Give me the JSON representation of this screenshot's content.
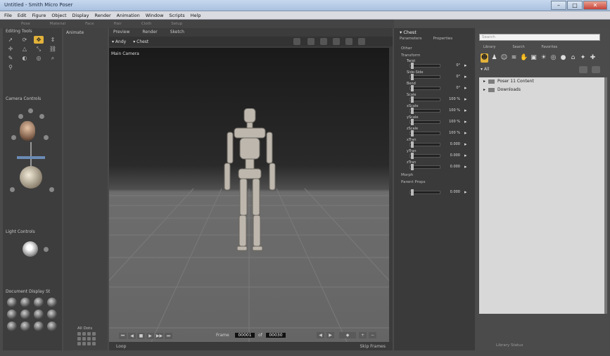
{
  "window": {
    "title": "Untitled - Smith Micro Poser"
  },
  "menu": [
    "File",
    "Edit",
    "Figure",
    "Object",
    "Display",
    "Render",
    "Animation",
    "Window",
    "Scripts",
    "Help"
  ],
  "room_tabs": [
    "Pose",
    "Material",
    "Face",
    "Hair",
    "Cloth",
    "Setup"
  ],
  "editing_tools": {
    "title": "Editing Tools"
  },
  "camera_controls": {
    "title": "Camera Controls"
  },
  "light_controls": {
    "title": "Light Controls"
  },
  "document_display": {
    "title": "Document Display St"
  },
  "anim": {
    "label": "Animate",
    "all_dots": "All Dots"
  },
  "viewport": {
    "tabs": [
      "Preview",
      "Render",
      "Sketch"
    ],
    "dropdowns": [
      "Andy",
      "Chest"
    ],
    "camera_label": "Main Camera"
  },
  "frame": {
    "label": "Frame",
    "current": "00001",
    "of": "of",
    "total": "00030"
  },
  "bottom": {
    "loop": "Loop",
    "skip": "Skip Frames"
  },
  "params": {
    "header": "Chest",
    "tabs": [
      "Parameters",
      "Properties"
    ],
    "group_other": "Other",
    "group_transform": "Transform",
    "rows": [
      {
        "name": "Twist",
        "value": "0°"
      },
      {
        "name": "Side-Side",
        "value": "0°"
      },
      {
        "name": "Bend",
        "value": "0°"
      },
      {
        "name": "Scale",
        "value": "100 %"
      },
      {
        "name": "xScale",
        "value": "100 %"
      },
      {
        "name": "yScale",
        "value": "100 %"
      },
      {
        "name": "zScale",
        "value": "100 %"
      },
      {
        "name": "xTran",
        "value": "0.000"
      },
      {
        "name": "yTran",
        "value": "0.000"
      },
      {
        "name": "zTran",
        "value": "0.000"
      }
    ],
    "group_morph": "Morph",
    "group_parent": "Parent Props",
    "parent_value": "0.000"
  },
  "library": {
    "search_placeholder": "Search",
    "tabs": [
      "Library",
      "Search",
      "Favorites"
    ],
    "all_label": "All",
    "tree": [
      "Poser 11 Content",
      "Downloads"
    ]
  },
  "status": {
    "text": "Library Status"
  },
  "colors": {
    "accent": "#e2b23a"
  }
}
